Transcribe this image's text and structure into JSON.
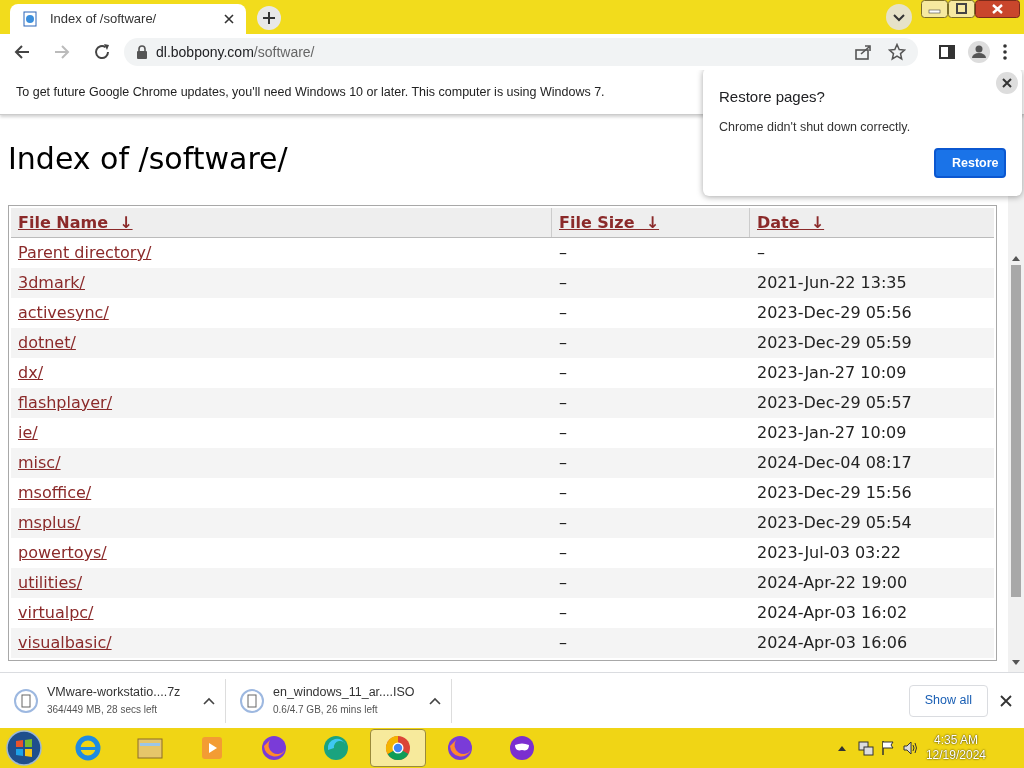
{
  "tab": {
    "title": "Index of /software/"
  },
  "address": {
    "host": "dl.bobpony.com",
    "path": "/software/"
  },
  "infobar": {
    "text": "To get future Google Chrome updates, you'll need Windows 10 or later. This computer is using Windows 7."
  },
  "popup": {
    "title": "Restore pages?",
    "message": "Chrome didn't shut down correctly.",
    "button": "Restore"
  },
  "heading": "Index of /software/",
  "table": {
    "columns": [
      "File Name  ↓",
      "File Size  ↓",
      "Date  ↓"
    ],
    "rows": [
      {
        "name": "Parent directory/",
        "size": "–",
        "date": "–"
      },
      {
        "name": "3dmark/",
        "size": "–",
        "date": "2021-Jun-22 13:35"
      },
      {
        "name": "activesync/",
        "size": "–",
        "date": "2023-Dec-29 05:56"
      },
      {
        "name": "dotnet/",
        "size": "–",
        "date": "2023-Dec-29 05:59"
      },
      {
        "name": "dx/",
        "size": "–",
        "date": "2023-Jan-27 10:09"
      },
      {
        "name": "flashplayer/",
        "size": "–",
        "date": "2023-Dec-29 05:57"
      },
      {
        "name": "ie/",
        "size": "–",
        "date": "2023-Jan-27 10:09"
      },
      {
        "name": "misc/",
        "size": "–",
        "date": "2024-Dec-04 08:17"
      },
      {
        "name": "msoffice/",
        "size": "–",
        "date": "2023-Dec-29 15:56"
      },
      {
        "name": "msplus/",
        "size": "–",
        "date": "2023-Dec-29 05:54"
      },
      {
        "name": "powertoys/",
        "size": "–",
        "date": "2023-Jul-03 03:22"
      },
      {
        "name": "utilities/",
        "size": "–",
        "date": "2024-Apr-22 19:00"
      },
      {
        "name": "virtualpc/",
        "size": "–",
        "date": "2024-Apr-03 16:02"
      },
      {
        "name": "visualbasic/",
        "size": "–",
        "date": "2024-Apr-03 16:06"
      }
    ]
  },
  "downloads": [
    {
      "name": "VMware-workstatio....7z",
      "status": "364/449 MB, 28 secs left"
    },
    {
      "name": "en_windows_11_ar....ISO",
      "status": "0.6/4.7 GB, 26 mins left"
    }
  ],
  "show_all": "Show all",
  "taskbar": {
    "apps": [
      {
        "kind": "ie",
        "selected": false
      },
      {
        "kind": "explorer",
        "selected": false
      },
      {
        "kind": "media",
        "selected": false
      },
      {
        "kind": "firefox",
        "selected": false
      },
      {
        "kind": "edge",
        "selected": false
      },
      {
        "kind": "chrome",
        "selected": true
      },
      {
        "kind": "firefox",
        "selected": false
      },
      {
        "kind": "mask",
        "selected": false
      }
    ],
    "time": "4:35 AM",
    "date": "12/19/2024"
  }
}
